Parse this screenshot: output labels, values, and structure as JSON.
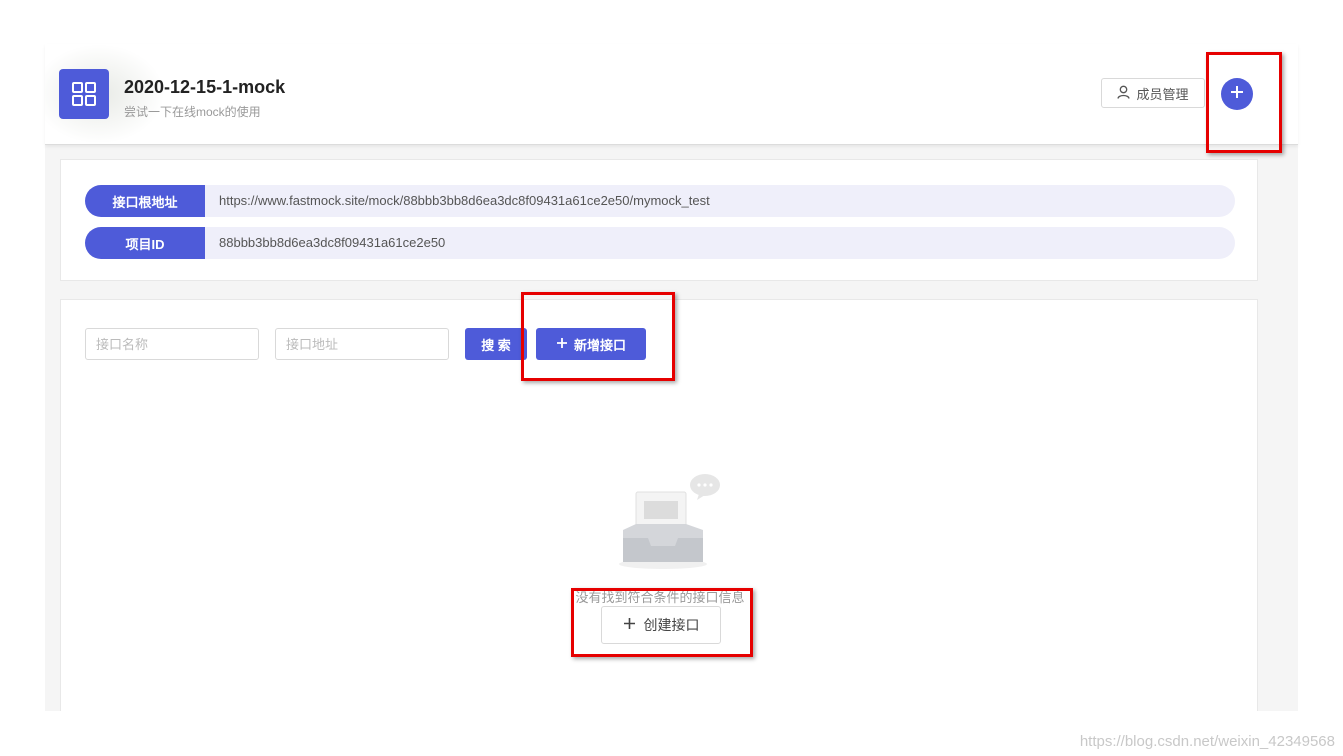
{
  "header": {
    "project_title": "2020-12-15-1-mock",
    "project_desc": "尝试一下在线mock的使用",
    "member_button_label": "成员管理",
    "icons": {
      "logo": "grid-icon",
      "member": "user-icon",
      "add": "plus-icon"
    }
  },
  "info": {
    "rows": [
      {
        "label": "接口根地址",
        "value": "https://www.fastmock.site/mock/88bbb3bb8d6ea3dc8f09431a61ce2e50/mymock_test"
      },
      {
        "label": "项目ID",
        "value": "88bbb3bb8d6ea3dc8f09431a61ce2e50"
      }
    ]
  },
  "toolbar": {
    "name_placeholder": "接口名称",
    "url_placeholder": "接口地址",
    "search_label": "搜 索",
    "add_interface_label": "新增接口"
  },
  "empty_state": {
    "message": "没有找到符合条件的接口信息",
    "create_label": "创建接口",
    "icon": "empty-inbox-icon"
  },
  "watermark": "https://blog.csdn.net/weixin_42349568",
  "colors": {
    "accent": "#4e5bd9",
    "highlight": "#e60000"
  }
}
